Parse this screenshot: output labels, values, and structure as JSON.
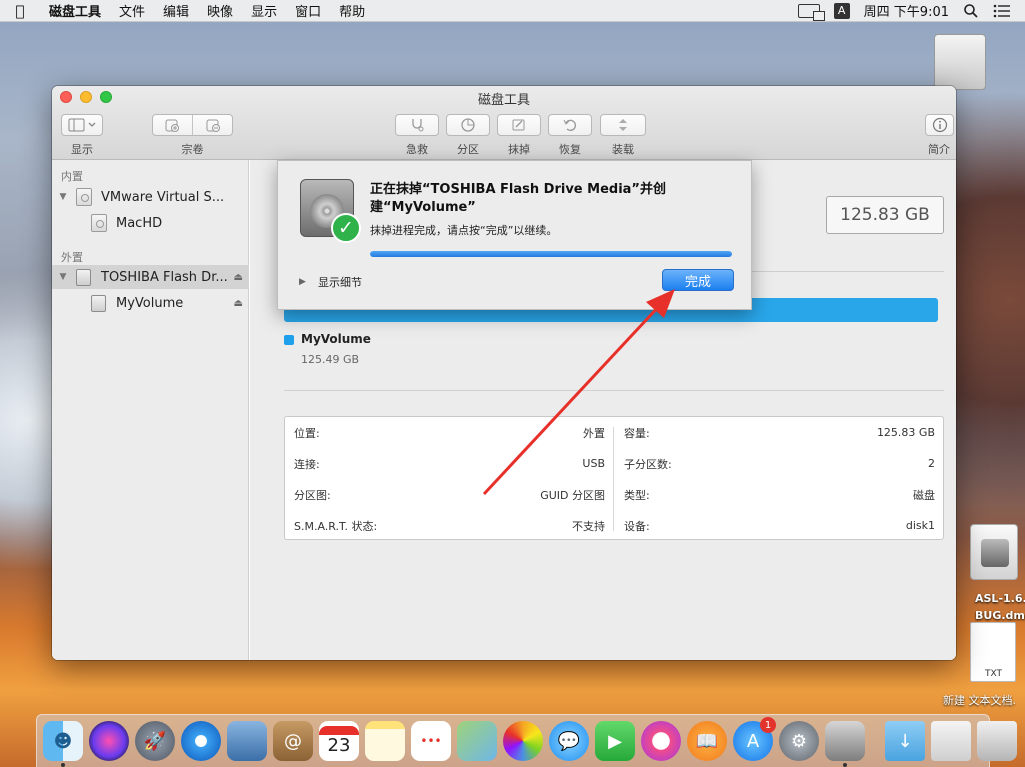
{
  "menubar": {
    "app_name": "磁盘工具",
    "items": [
      "文件",
      "编辑",
      "映像",
      "显示",
      "窗口",
      "帮助"
    ],
    "input_source": "A",
    "clock": "周四 下午9:01"
  },
  "window": {
    "title": "磁盘工具",
    "toolbar": {
      "view_label": "显示",
      "volume_label": "宗卷",
      "first_aid_label": "急救",
      "partition_label": "分区",
      "erase_label": "抹掉",
      "restore_label": "恢复",
      "mount_label": "装载",
      "info_label": "简介"
    }
  },
  "sidebar": {
    "internal_header": "内置",
    "external_header": "外置",
    "internal_disk": "VMware Virtual S...",
    "internal_volume": "MacHD",
    "external_disk": "TOSHIBA Flash Dr...",
    "external_volume": "MyVolume"
  },
  "main": {
    "capacity": "125.83 GB",
    "volume_name": "MyVolume",
    "volume_size": "125.49 GB",
    "info_left": [
      {
        "key": "位置:",
        "value": "外置"
      },
      {
        "key": "连接:",
        "value": "USB"
      },
      {
        "key": "分区图:",
        "value": "GUID 分区图"
      },
      {
        "key": "S.M.A.R.T. 状态:",
        "value": "不支持"
      }
    ],
    "info_right": [
      {
        "key": "容量:",
        "value": "125.83 GB"
      },
      {
        "key": "子分区数:",
        "value": "2"
      },
      {
        "key": "类型:",
        "value": "磁盘"
      },
      {
        "key": "设备:",
        "value": "disk1"
      }
    ]
  },
  "dialog": {
    "title": "正在抹掉“TOSHIBA Flash Drive Media”并创建“MyVolume”",
    "message": "抹掉进程完成，请点按“完成”以继续。",
    "progress": 1.0,
    "details_label": "显示细节",
    "done_label": "完成"
  },
  "desktop": {
    "dmg_label_1": "ASL-1.6.",
    "dmg_label_2": "BUG.dmg",
    "txt_badge": "TXT",
    "txt_label": "新建 文本文档.",
    "calendar_day": "23",
    "appstore_badge": "1"
  },
  "colors": {
    "accent": "#1b7ff0",
    "usage_bar": "#29a6ea",
    "success": "#2fb24a"
  }
}
